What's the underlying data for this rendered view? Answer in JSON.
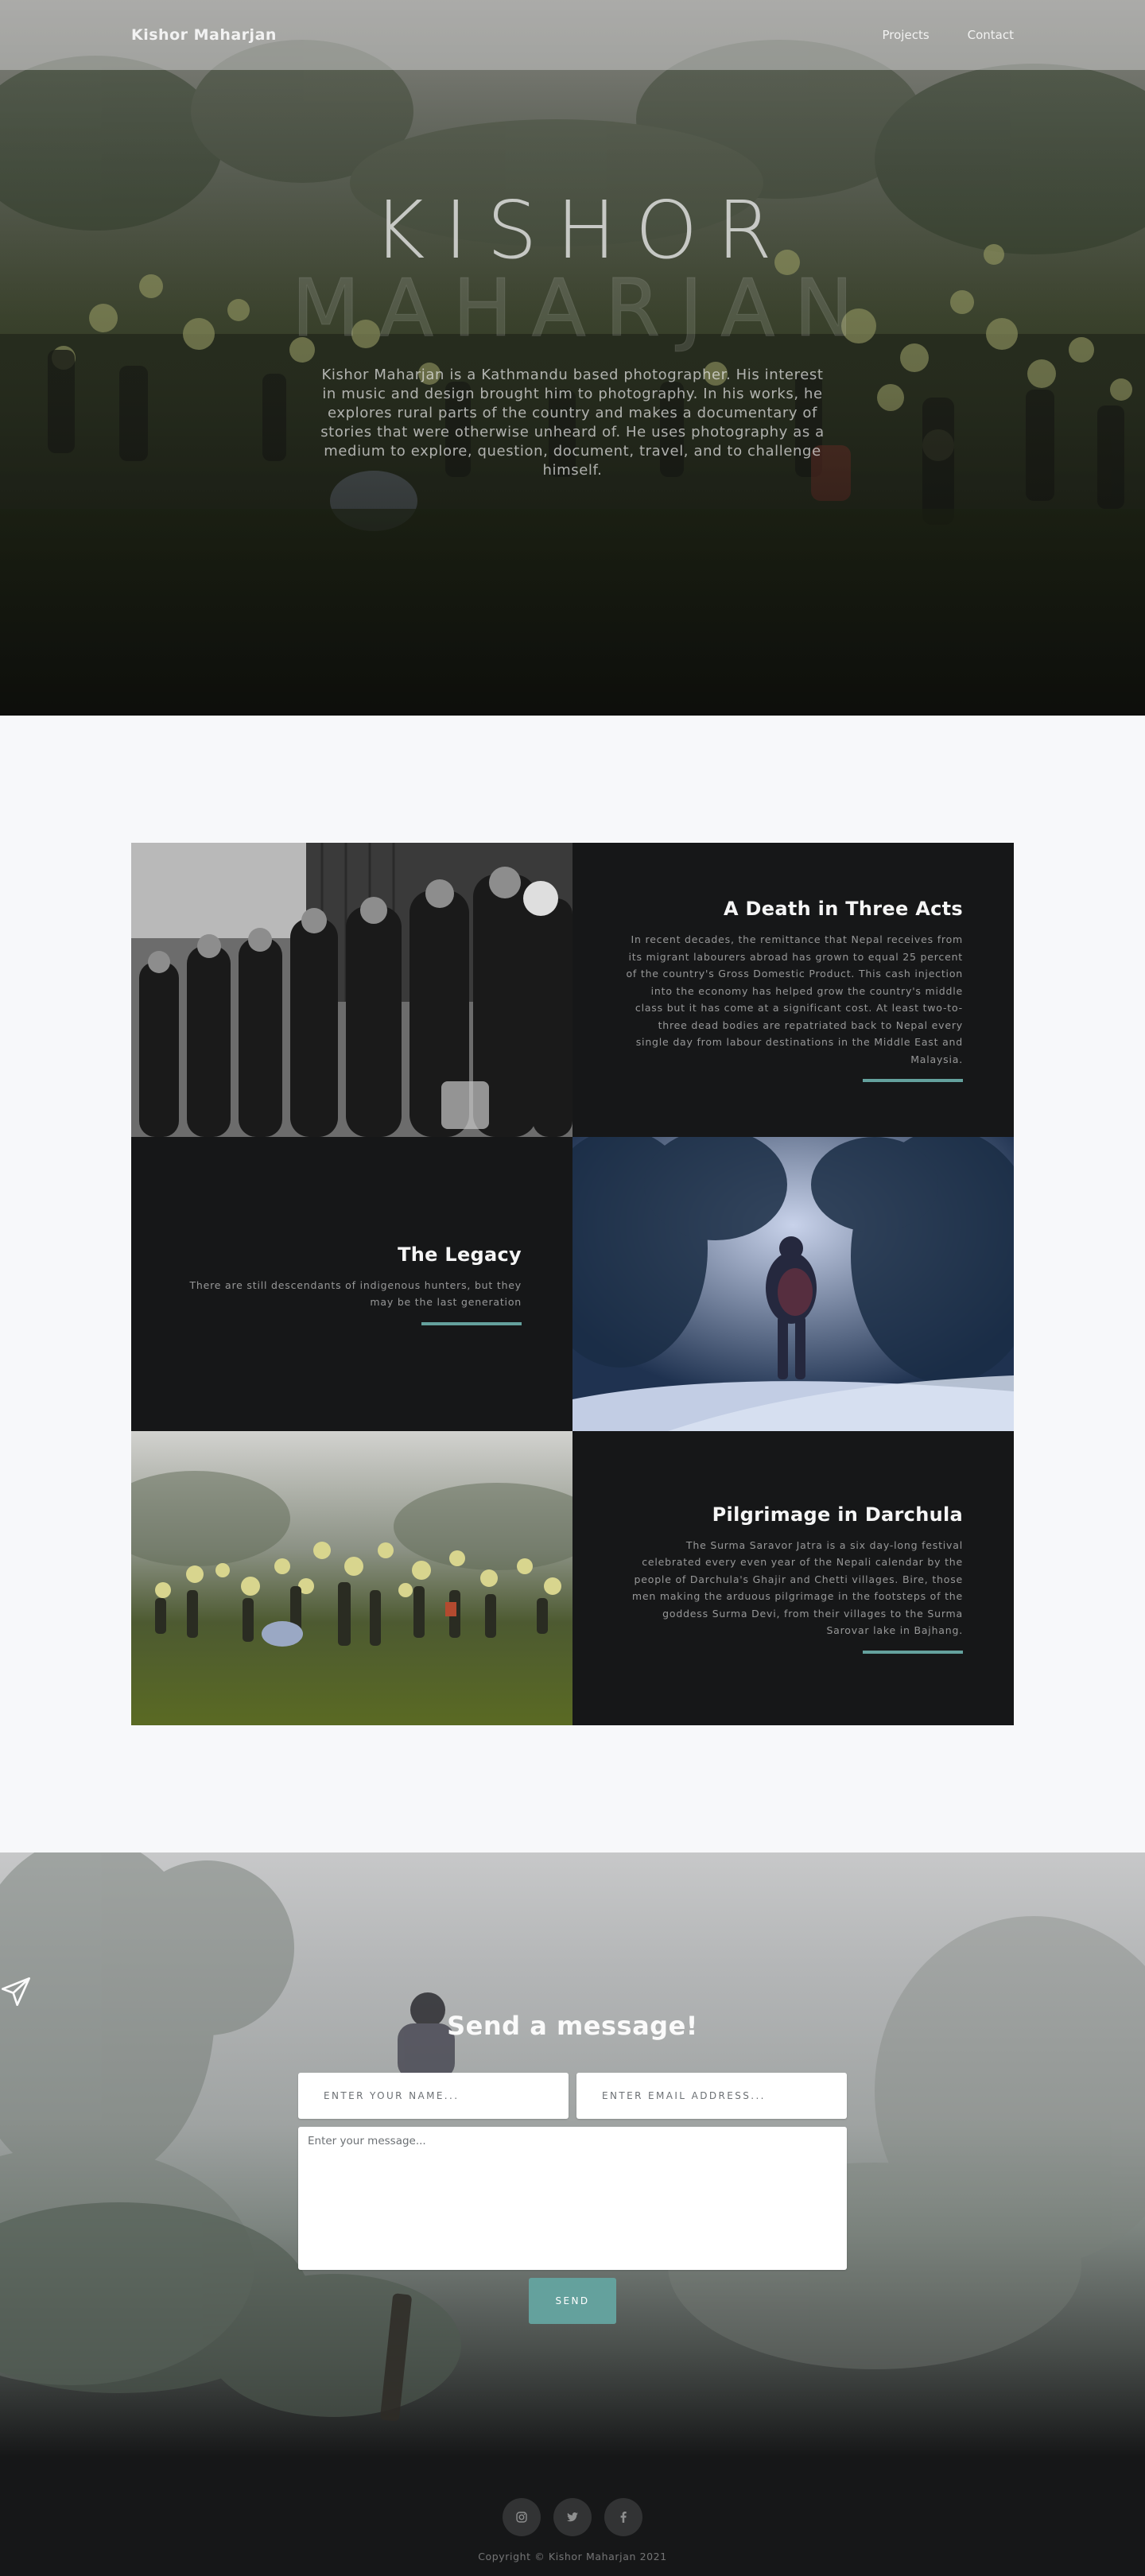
{
  "nav": {
    "brand": "Kishor Maharjan",
    "links": [
      "Projects",
      "Contact"
    ]
  },
  "hero": {
    "title_line1": "KISHOR",
    "title_line2": "MAHARJAN",
    "description": "Kishor Maharjan is a Kathmandu based photographer. His interest in music and design brought him to photography. In his works, he explores rural parts of the country and makes a documentary of stories that were otherwise unheard of. He uses photography as a medium to explore, question, document, travel, and to challenge himself."
  },
  "projects": [
    {
      "title": "A Death in Three Acts",
      "description": "In recent decades, the remittance that Nepal receives from its migrant labourers abroad has grown to equal 25 percent of the country's Gross Domestic Product. This cash injection into the economy has helped grow the country's middle class but it has come at a significant cost. At least two-to-three dead bodies are repatriated back to Nepal every single day from labour destinations in the Middle East and Malaysia."
    },
    {
      "title": "The Legacy",
      "description": "There are still descendants of indigenous hunters, but they may be the last generation"
    },
    {
      "title": "Pilgrimage in Darchula",
      "description": "The Surma Saravor Jatra is a six day-long festival celebrated every even year of the Nepali calendar by the people of Darchula's Ghajir and Chetti villages. Bire, those men making the arduous pilgrimage in the footsteps of the goddess Surma Devi, from their villages to the Surma Sarovar lake in Bajhang."
    }
  ],
  "contact": {
    "icon": "paper-plane-icon",
    "title": "Send a message!",
    "name_placeholder": "ENTER YOUR NAME...",
    "email_placeholder": "ENTER EMAIL ADDRESS...",
    "message_placeholder": "Enter your message...",
    "send_label": "SEND"
  },
  "footer": {
    "socials": [
      "instagram-icon",
      "twitter-icon",
      "facebook-icon"
    ],
    "copyright": "Copyright © Kishor Maharjan 2021"
  },
  "colors": {
    "accent": "#64a19d",
    "dark": "#161718",
    "light_bg": "#f7f8fa"
  }
}
